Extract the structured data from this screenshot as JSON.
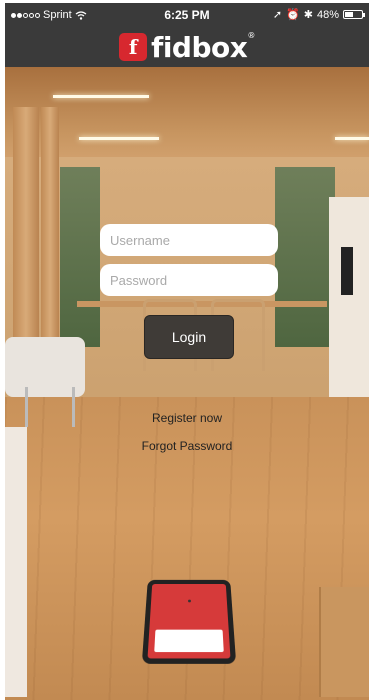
{
  "status_bar": {
    "carrier": "Sprint",
    "time": "6:25 PM",
    "battery": "48%"
  },
  "header": {
    "logo_mark": "f",
    "logo_text": "fidbox",
    "logo_registered": "®"
  },
  "form": {
    "username_placeholder": "Username",
    "username_value": "",
    "password_placeholder": "Password",
    "password_value": "",
    "login_label": "Login",
    "register_label": "Register now",
    "forgot_label": "Forgot Password"
  },
  "colors": {
    "brand_red": "#d7282f",
    "header_bg": "#3a3a3a",
    "button_bg": "#3f3b37"
  }
}
